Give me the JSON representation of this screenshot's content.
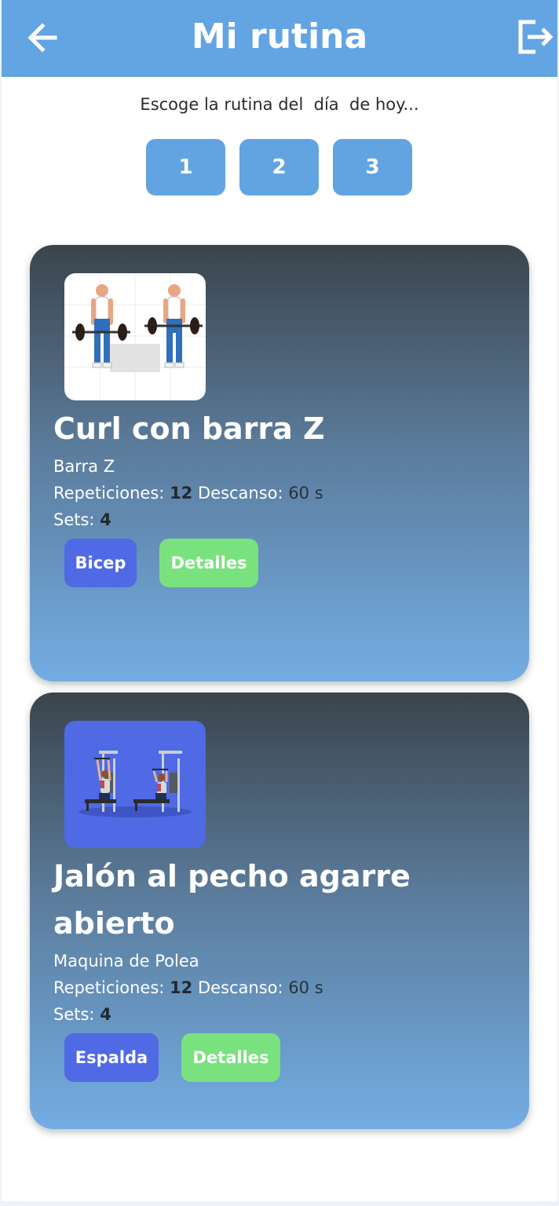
{
  "header": {
    "title": "Mi rutina",
    "back_icon": "arrow-left-icon",
    "logout_icon": "logout-icon"
  },
  "subtitle": "Escoge la rutina del  día  de hoy...",
  "routine_buttons": [
    "1",
    "2",
    "3"
  ],
  "labels": {
    "repeticiones": "Repeticiones:",
    "descanso": "Descanso:",
    "sets": "Sets:"
  },
  "exercises": [
    {
      "title": "Curl con barra Z",
      "equipment": "Barra Z",
      "reps": "12",
      "rest": "60 s",
      "sets": "4",
      "muscle": "Bicep",
      "details": "Detalles",
      "image": "barbell-curl-illustration"
    },
    {
      "title": "Jalón al pecho agarre abierto",
      "equipment": "Maquina de Polea",
      "reps": "12",
      "rest": "60 s",
      "sets": "4",
      "muscle": "Espalda",
      "details": "Detalles",
      "image": "lat-pulldown-illustration"
    }
  ],
  "colors": {
    "header": "#63a4e3",
    "muscle_tag": "#4f6ae4",
    "details_tag": "#79e27e"
  }
}
